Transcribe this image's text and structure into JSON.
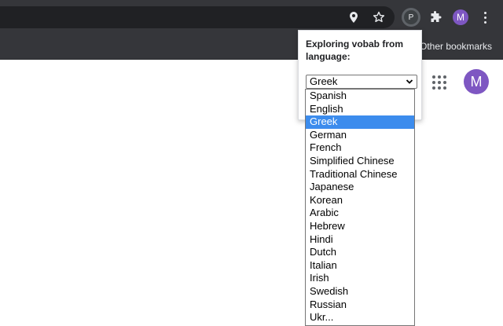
{
  "toolbar": {
    "icons": [
      "location-pin-icon",
      "star-icon",
      "extension-p-icon",
      "puzzle-icon",
      "profile-avatar",
      "more-menu-icon"
    ],
    "extension_letter": "P",
    "profile_initial": "M"
  },
  "bookmarks": {
    "other_label": "Other bookmarks"
  },
  "page": {
    "avatar_initial": "M"
  },
  "popup": {
    "title": "Exploring vobab from language:",
    "selected_value": "Greek",
    "options": [
      "Spanish",
      "English",
      "Greek",
      "German",
      "French",
      "Simplified Chinese",
      "Traditional Chinese",
      "Japanese",
      "Korean",
      "Arabic",
      "Hebrew",
      "Hindi",
      "Dutch",
      "Italian",
      "Irish",
      "Swedish",
      "Russian",
      "Ukr..."
    ],
    "highlighted_index": 2
  },
  "colors": {
    "toolbar": "#35363a",
    "omnibox": "#202124",
    "highlight": "#3c8ced",
    "avatar": "#7e57c2"
  }
}
